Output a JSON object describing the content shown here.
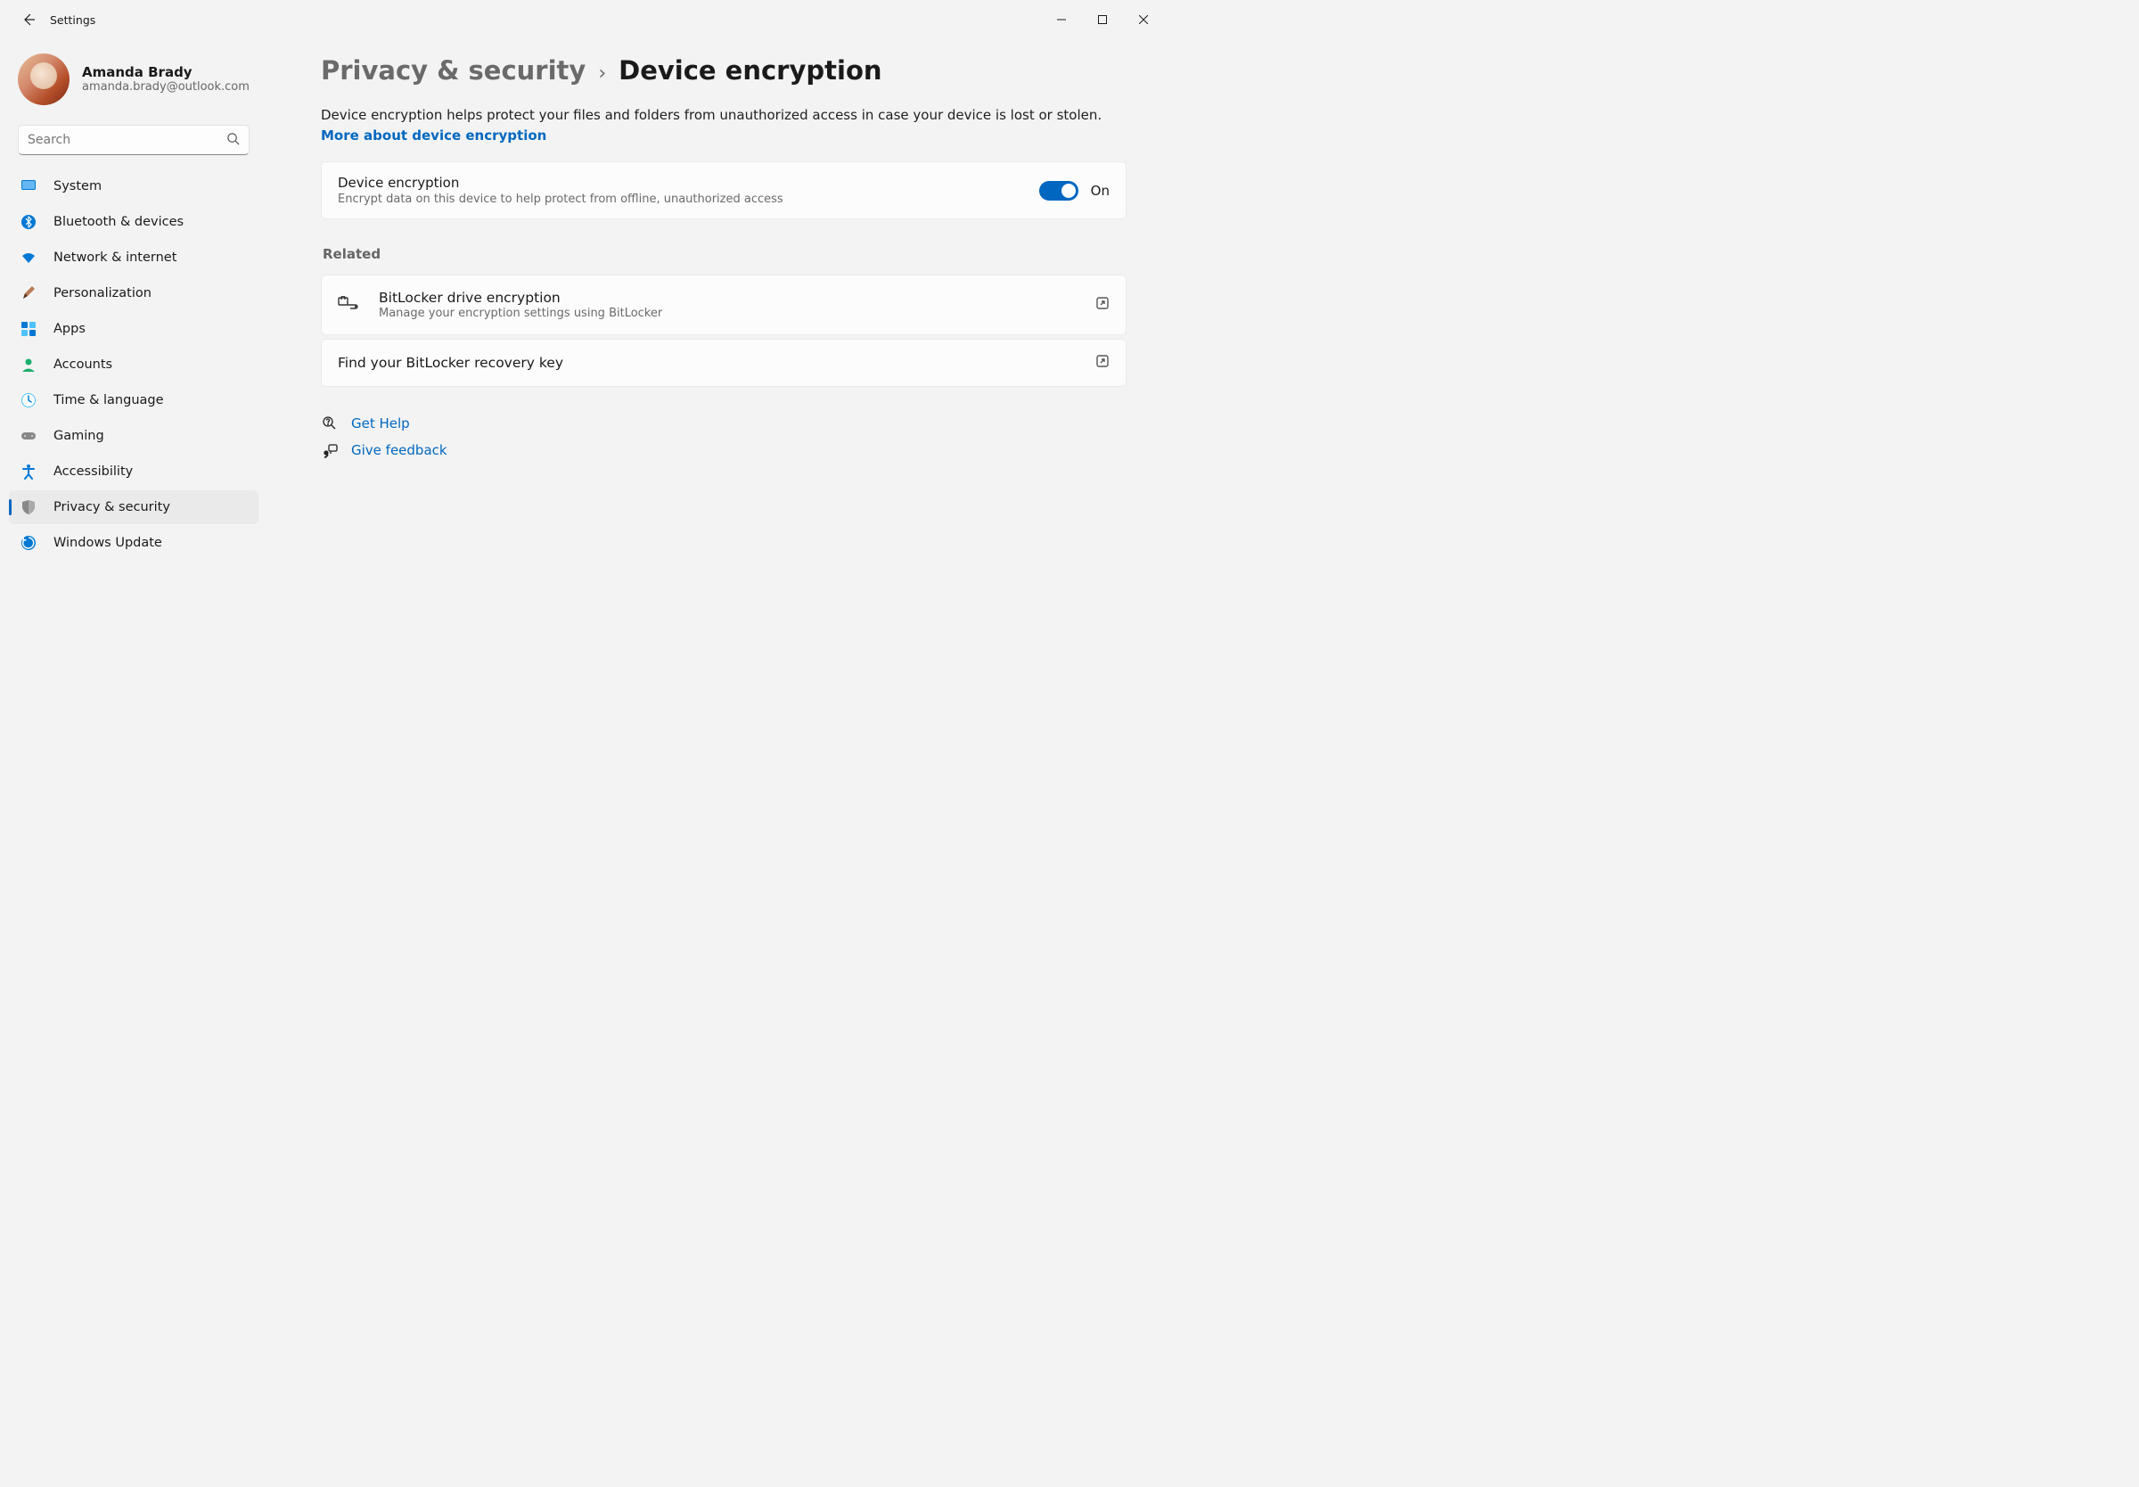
{
  "titlebar": {
    "title": "Settings"
  },
  "profile": {
    "name": "Amanda Brady",
    "email": "amanda.brady@outlook.com"
  },
  "search": {
    "placeholder": "Search"
  },
  "nav": {
    "items": [
      {
        "label": "System"
      },
      {
        "label": "Bluetooth & devices"
      },
      {
        "label": "Network & internet"
      },
      {
        "label": "Personalization"
      },
      {
        "label": "Apps"
      },
      {
        "label": "Accounts"
      },
      {
        "label": "Time & language"
      },
      {
        "label": "Gaming"
      },
      {
        "label": "Accessibility"
      },
      {
        "label": "Privacy & security"
      },
      {
        "label": "Windows Update"
      }
    ],
    "selected_index": 9
  },
  "breadcrumb": {
    "parent": "Privacy & security",
    "current": "Device encryption"
  },
  "description": {
    "text": "Device encryption helps protect your files and folders from unauthorized access in case your device is lost or stolen. ",
    "link": "More about device encryption"
  },
  "encryption_card": {
    "title": "Device encryption",
    "subtitle": "Encrypt data on this device to help protect from offline, unauthorized access",
    "toggle_state": "On"
  },
  "related": {
    "heading": "Related",
    "items": [
      {
        "title": "BitLocker drive encryption",
        "subtitle": "Manage your encryption settings using BitLocker"
      },
      {
        "title": "Find your BitLocker recovery key",
        "subtitle": ""
      }
    ]
  },
  "help": {
    "get_help": "Get Help",
    "feedback": "Give feedback"
  }
}
